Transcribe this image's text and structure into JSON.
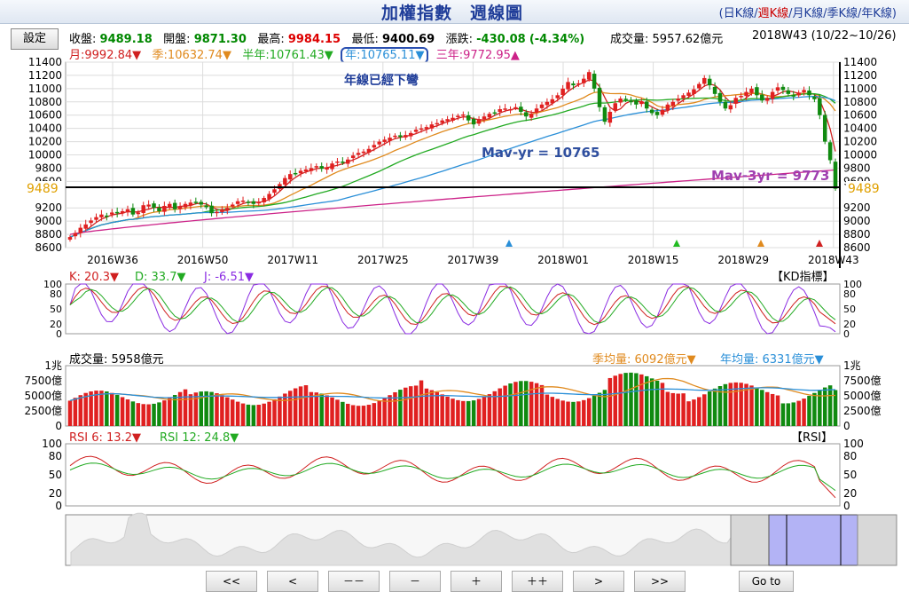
{
  "header": {
    "title": "加權指數　週線圖",
    "periods": [
      "日K線",
      "週K線",
      "月K線",
      "季K線",
      "年K線"
    ],
    "selected_period": "週K線"
  },
  "toolbar": {
    "settings_label": "設定",
    "close_label": "收盤:",
    "close": "9489.18",
    "open_label": "開盤:",
    "open": "9871.30",
    "high_label": "最高:",
    "high": "9984.15",
    "low_label": "最低:",
    "low": "9400.69",
    "change_label": "漲跌:",
    "change": "-430.08",
    "change_pct": "(-4.34%)",
    "volume_label": "成交量:",
    "volume": "5957.62億元",
    "week": "2018W43 (10/22~10/26)"
  },
  "ma_legend": [
    {
      "label": "月:9992.84▼",
      "color": "#d02020"
    },
    {
      "label": "季:10632.74▼",
      "color": "#e08a1e"
    },
    {
      "label": "半年:10761.43▼",
      "color": "#22aa22"
    },
    {
      "label": "年:10765.11▼",
      "color": "#2a8fd8"
    },
    {
      "label": "三年:9772.95▲",
      "color": "#cc2288"
    }
  ],
  "annotations": {
    "year_line_down": "年線已經下彎",
    "mav_yr": "Mav-yr = 10765",
    "mav_3yr": "Mav-3yr = 9773",
    "current_left": "9489",
    "current_right": "9489"
  },
  "kd_panel": {
    "k": "K: 20.3▼",
    "d": "D: 33.7▼",
    "j": "J: -6.51▼",
    "title": "【KD指標】",
    "ticks": [
      "100",
      "80",
      "50",
      "20",
      "0"
    ]
  },
  "volume_panel": {
    "label": "成交量: 5958億元",
    "season_avg": "季均量: 6092億元▼",
    "year_avg": "年均量: 6331億元▼",
    "ticks": [
      "1兆",
      "7500億",
      "5000億",
      "2500億",
      "0"
    ]
  },
  "rsi_panel": {
    "rsi6": "RSI 6: 13.2▼",
    "rsi12": "RSI 12: 24.8▼",
    "title": "【RSI】",
    "ticks": [
      "100",
      "80",
      "50",
      "20",
      "0"
    ]
  },
  "navigation": {
    "buttons": [
      "<<",
      "<",
      "－－",
      "－",
      "＋",
      "＋＋",
      ">",
      ">>"
    ],
    "goto_label": "Go to"
  },
  "chart_data": {
    "type": "candlestick",
    "x_ticks": [
      "2016W36",
      "2016W50",
      "2017W11",
      "2017W25",
      "2017W39",
      "2018W01",
      "2018W15",
      "2018W29",
      "2018W43"
    ],
    "y_ticks": [
      11400,
      11200,
      11000,
      10800,
      10600,
      10400,
      10200,
      10000,
      9800,
      9600,
      9200,
      9000,
      8800,
      8600
    ],
    "ylim": [
      8600,
      11400
    ],
    "current_price": 9489,
    "close_series": [
      8760,
      8820,
      8900,
      8950,
      9010,
      9060,
      9100,
      9080,
      9130,
      9120,
      9150,
      9180,
      9100,
      9130,
      9240,
      9250,
      9200,
      9150,
      9230,
      9260,
      9180,
      9220,
      9260,
      9280,
      9290,
      9250,
      9210,
      9120,
      9140,
      9180,
      9200,
      9250,
      9300,
      9310,
      9280,
      9260,
      9290,
      9350,
      9410,
      9480,
      9560,
      9650,
      9710,
      9720,
      9760,
      9780,
      9800,
      9830,
      9790,
      9810,
      9870,
      9900,
      9880,
      9930,
      9990,
      10030,
      10050,
      10090,
      10150,
      10200,
      10230,
      10260,
      10290,
      10270,
      10300,
      10330,
      10380,
      10400,
      10420,
      10460,
      10480,
      10520,
      10540,
      10560,
      10590,
      10610,
      10520,
      10460,
      10540,
      10580,
      10620,
      10640,
      10690,
      10700,
      10690,
      10720,
      10650,
      10580,
      10620,
      10700,
      10760,
      10800,
      10840,
      10900,
      11000,
      11100,
      11050,
      11080,
      11150,
      11250,
      11000,
      10720,
      10500,
      10650,
      10780,
      10850,
      10830,
      10800,
      10760,
      10810,
      10700,
      10630,
      10600,
      10680,
      10760,
      10800,
      10850,
      10900,
      10940,
      10990,
      11070,
      11160,
      11050,
      10920,
      10800,
      10700,
      10750,
      10860,
      10890,
      10950,
      11000,
      10900,
      10820,
      10860,
      10950,
      11020,
      10980,
      10920,
      10880,
      10940,
      10980,
      10900,
      10840,
      10600,
      10200,
      9920,
      9489
    ],
    "series": [
      {
        "name": "月",
        "color": "#d02020"
      },
      {
        "name": "季",
        "color": "#e08a1e"
      },
      {
        "name": "半年",
        "color": "#22aa22"
      },
      {
        "name": "年",
        "color": "#2a8fd8"
      },
      {
        "name": "三年",
        "color": "#cc2288"
      }
    ]
  }
}
